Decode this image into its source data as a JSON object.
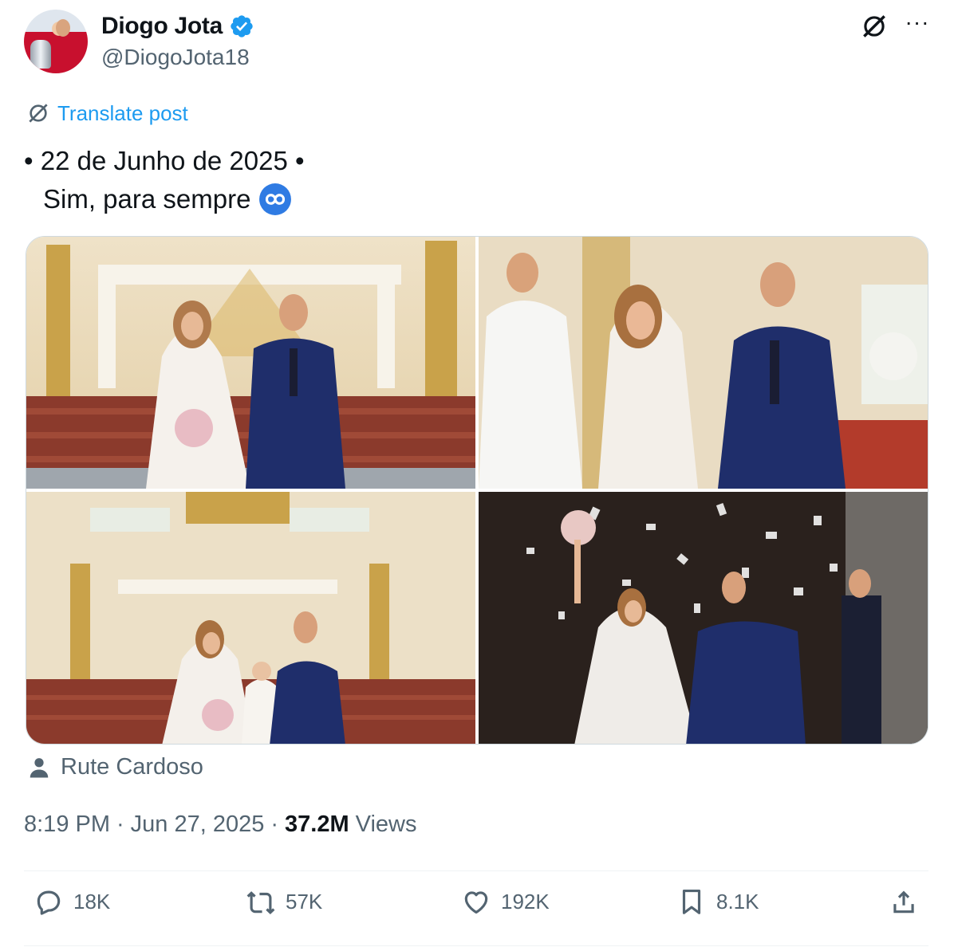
{
  "author": {
    "display_name": "Diogo Jota",
    "handle": "@DiogoJota18",
    "verified": true
  },
  "translate_label": "Translate post",
  "post": {
    "line1": "• 22 de Junho de 2025 •",
    "line2": "Sim, para sempre",
    "emoji": "infinity"
  },
  "media": {
    "count": 4
  },
  "photo_credit": "Rute Cardoso",
  "timestamp": {
    "time": "8:19 PM",
    "separator": "·",
    "date": "Jun 27, 2025",
    "views_count": "37.2M",
    "views_label": "Views"
  },
  "actions": {
    "replies": "18K",
    "reposts": "57K",
    "likes": "192K",
    "bookmarks": "8.1K"
  },
  "colors": {
    "accent": "#1d9bf0",
    "text": "#0f1419",
    "secondary": "#536471",
    "suit": "#1f2e6b"
  },
  "icons": [
    "verified-icon",
    "grok-icon",
    "more-icon",
    "translate-icon",
    "infinity-emoji",
    "person-icon",
    "reply-icon",
    "repost-icon",
    "like-icon",
    "bookmark-icon",
    "share-icon"
  ]
}
